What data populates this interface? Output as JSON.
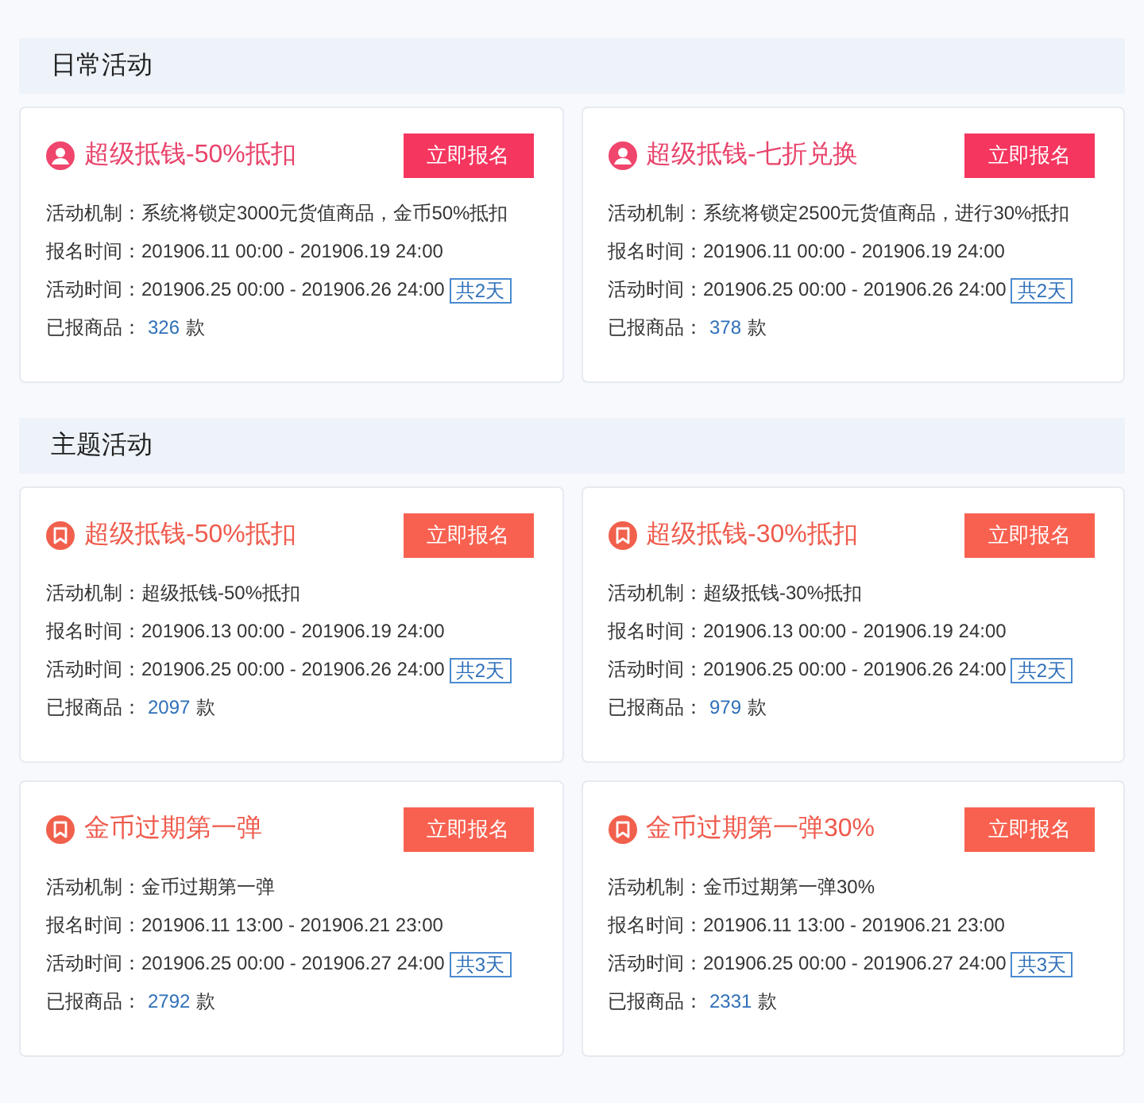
{
  "sections": [
    {
      "title": "日常活动",
      "cards": [
        {
          "kind": "person",
          "title": "超级抵钱-50%抵扣",
          "button": "立即报名",
          "mechanism": "活动机制：系统将锁定3000元货值商品，金币50%抵扣",
          "signup_time": "报名时间：201906.11 00:00 - 201906.19 24:00",
          "event_time": "活动时间：201906.25 00:00 - 201906.26 24:00",
          "duration": "共2天",
          "count_label": "已报商品：",
          "count": "326",
          "count_unit": "款"
        },
        {
          "kind": "person",
          "title": "超级抵钱-七折兑换",
          "button": "立即报名",
          "mechanism": "活动机制：系统将锁定2500元货值商品，进行30%抵扣",
          "signup_time": "报名时间：201906.11 00:00 - 201906.19 24:00",
          "event_time": "活动时间：201906.25 00:00 - 201906.26 24:00",
          "duration": "共2天",
          "count_label": "已报商品：",
          "count": "378",
          "count_unit": "款"
        }
      ]
    },
    {
      "title": "主题活动",
      "cards": [
        {
          "kind": "bookmark",
          "title": "超级抵钱-50%抵扣",
          "button": "立即报名",
          "mechanism": "活动机制：超级抵钱-50%抵扣",
          "signup_time": "报名时间：201906.13 00:00 - 201906.19 24:00",
          "event_time": "活动时间：201906.25 00:00 - 201906.26 24:00",
          "duration": "共2天",
          "count_label": "已报商品：",
          "count": "2097",
          "count_unit": "款"
        },
        {
          "kind": "bookmark",
          "title": "超级抵钱-30%抵扣",
          "button": "立即报名",
          "mechanism": "活动机制：超级抵钱-30%抵扣",
          "signup_time": "报名时间：201906.13 00:00 - 201906.19 24:00",
          "event_time": "活动时间：201906.25 00:00 - 201906.26 24:00",
          "duration": "共2天",
          "count_label": "已报商品：",
          "count": "979",
          "count_unit": "款"
        },
        {
          "kind": "bookmark",
          "title": "金币过期第一弹",
          "button": "立即报名",
          "mechanism": "活动机制：金币过期第一弹",
          "signup_time": "报名时间：201906.11 13:00 - 201906.21 23:00",
          "event_time": "活动时间：201906.25 00:00 - 201906.27 24:00",
          "duration": "共3天",
          "count_label": "已报商品：",
          "count": "2792",
          "count_unit": "款"
        },
        {
          "kind": "bookmark",
          "title": "金币过期第一弹30%",
          "button": "立即报名",
          "mechanism": "活动机制：金币过期第一弹30%",
          "signup_time": "报名时间：201906.11 13:00 - 201906.21 23:00",
          "event_time": "活动时间：201906.25 00:00 - 201906.27 24:00",
          "duration": "共3天",
          "count_label": "已报商品：",
          "count": "2331",
          "count_unit": "款"
        }
      ]
    }
  ]
}
